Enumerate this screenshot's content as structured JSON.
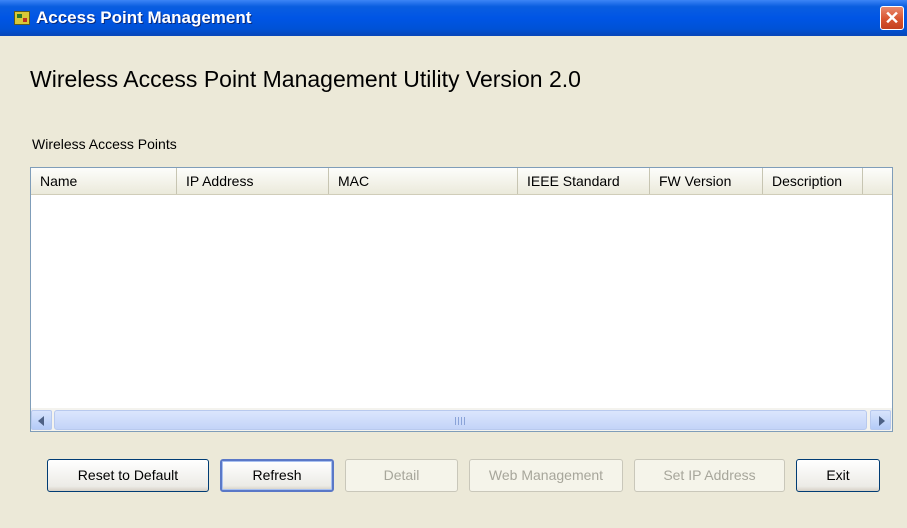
{
  "window": {
    "title": "Access Point Management",
    "close_icon": "close-icon",
    "app_icon": "app-icon"
  },
  "main": {
    "heading": "Wireless Access Point Management Utility Version 2.0",
    "list_label": "Wireless Access Points",
    "columns": [
      "Name",
      "IP Address",
      "MAC",
      "IEEE Standard",
      "FW Version",
      "Description"
    ],
    "rows": []
  },
  "buttons": {
    "reset": "Reset to Default",
    "refresh": "Refresh",
    "detail": "Detail",
    "web_management": "Web Management",
    "set_ip": "Set IP Address",
    "exit": "Exit"
  },
  "colors": {
    "titlebar": "#0055e5",
    "window_bg": "#ece9d8",
    "close_button": "#d8542f"
  }
}
